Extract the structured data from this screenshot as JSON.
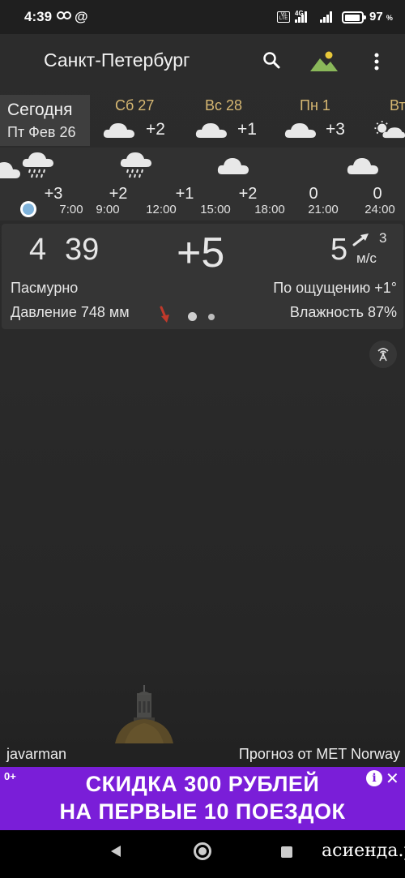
{
  "status_bar": {
    "time": "4:39",
    "network_type": "4G",
    "volte_label": "Vo LTE",
    "battery_percent": "97",
    "battery_unit": "%",
    "icons": [
      "link-icon",
      "at-icon",
      "volte-icon",
      "signal-icon",
      "battery-icon"
    ]
  },
  "app_bar": {
    "title": "Санкт-Петербург",
    "icons": [
      "search-icon",
      "wallpaper-icon",
      "menu-icon"
    ]
  },
  "days": {
    "today": {
      "label": "Сегодня",
      "date": "Пт Фев 26"
    },
    "forecast": [
      {
        "label": "Сб 27",
        "temp": "+2",
        "icon": "cloud-icon"
      },
      {
        "label": "Вс 28",
        "temp": "+1",
        "icon": "cloud-icon"
      },
      {
        "label": "Пн 1",
        "temp": "+3",
        "icon": "cloud-icon"
      },
      {
        "label": "Вт",
        "temp": "",
        "icon": "sun-cloud-icon"
      }
    ]
  },
  "hourly": [
    {
      "time": "",
      "temp": "",
      "icon": "cloud-icon"
    },
    {
      "time": "7:00",
      "temp": "+3",
      "icon": "rain-cloud-icon"
    },
    {
      "time": "9:00",
      "temp": "+2",
      "icon": ""
    },
    {
      "time": "12:00",
      "temp": "+1",
      "icon": "rain-cloud-icon"
    },
    {
      "time": "15:00",
      "temp": "+2",
      "icon": ""
    },
    {
      "time": "18:00",
      "temp": "0",
      "icon": "cloud-icon"
    },
    {
      "time": "21:00",
      "temp": "0",
      "icon": ""
    },
    {
      "time": "24:00",
      "temp": "",
      "icon": "cloud-icon"
    }
  ],
  "current": {
    "time_hours": "4",
    "time_minutes": "39",
    "temperature": "+5",
    "wind_speed": "5",
    "wind_gust": "3",
    "wind_unit": "м/с",
    "condition": "Пасмурно",
    "feels_like": "По ощущению +1°",
    "pressure": "Давление 748 мм",
    "humidity": "Влажность 87%"
  },
  "footer": {
    "photo_author": "javarman",
    "forecast_source": "Прогноз от MET Norway"
  },
  "ad": {
    "logo": "0+",
    "line_1": "СКИДКА 300 РУБЛЕЙ",
    "line_2": "НА ПЕРВЫЕ 10 ПОЕЗДОК",
    "info_icon": "i",
    "close_icon": "✕"
  },
  "watermark": "асиенда.ру",
  "colors": {
    "background": "#2a2a2a",
    "day_name": "#d7b872",
    "timeline_dot": "#7fb3db",
    "pressure_arrow": "#c0392b",
    "ad_background": "#7a1ed8",
    "wallpaper_icon": "#8ab85a"
  }
}
